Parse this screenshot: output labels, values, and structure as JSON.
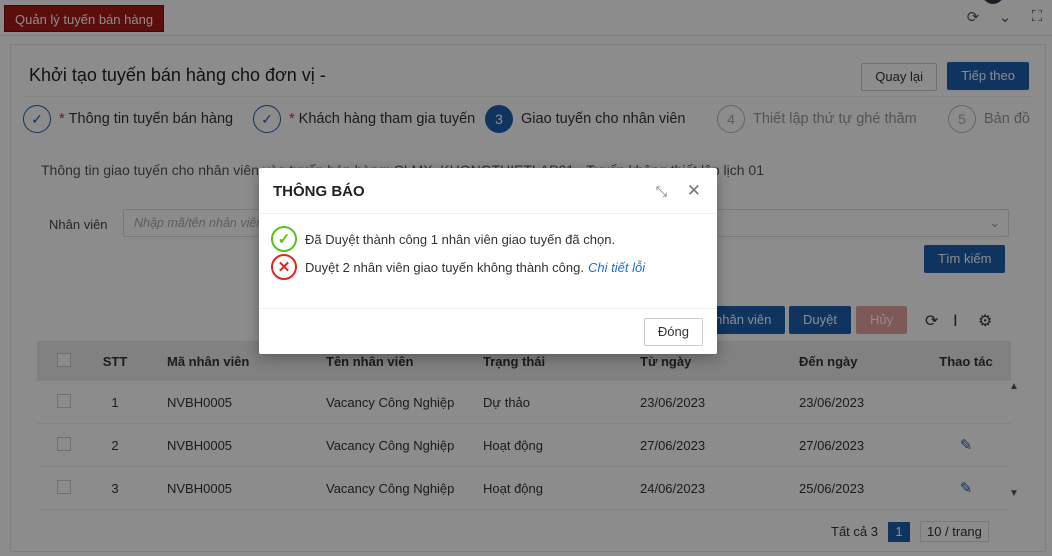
{
  "topbar": {
    "module_tab": "Quản lý tuyến bán hàng",
    "icons": [
      "refresh-icon",
      "chevron-down-icon",
      "fullscreen-icon"
    ]
  },
  "page": {
    "title": "Khởi tạo tuyến bán hàng cho đơn vị -",
    "back_label": "Quay lại",
    "next_label": "Tiếp theo"
  },
  "steps": [
    {
      "num": "✓",
      "label": "Thông tin tuyến bán hàng",
      "required": "*"
    },
    {
      "num": "✓",
      "label": "Khách hàng tham gia tuyến",
      "required": "*"
    },
    {
      "num": "3",
      "label": "Giao tuyến cho nhân viên"
    },
    {
      "num": "4",
      "label": "Thiết lập thứ tự ghé thăm"
    },
    {
      "num": "5",
      "label": "Bản đồ"
    }
  ],
  "section": {
    "title": "Thông tin giao tuyến cho nhân viên vào tuyến bán hàng: CLMX_KHONGTHIETLAP01 - Tuyến không thiết lập lịch 01"
  },
  "filter": {
    "label": "Nhân viên",
    "placeholder": "Nhập mã/tên nhân viên",
    "search_label": "Tìm kiếm"
  },
  "actions": {
    "assign_label": "nhân viên",
    "approve_label": "Duyệt",
    "cancel_label": "Hủy"
  },
  "table": {
    "headers": {
      "stt": "STT",
      "code": "Mã nhân viên",
      "name": "Tên nhân viên",
      "status": "Trạng thái",
      "from": "Từ ngày",
      "to": "Đến ngày",
      "action": "Thao tác"
    },
    "rows": [
      {
        "stt": "1",
        "code": "NVBH0005",
        "name": "Vacancy Công Nghiệp",
        "status": "Dự thảo",
        "from": "23/06/2023",
        "to": "23/06/2023",
        "action": ""
      },
      {
        "stt": "2",
        "code": "NVBH0005",
        "name": "Vacancy Công Nghiệp",
        "status": "Hoạt động",
        "from": "27/06/2023",
        "to": "27/06/2023",
        "action": "✎"
      },
      {
        "stt": "3",
        "code": "NVBH0005",
        "name": "Vacancy Công Nghiệp",
        "status": "Hoạt động",
        "from": "24/06/2023",
        "to": "25/06/2023",
        "action": "✎"
      }
    ]
  },
  "pager": {
    "total": "Tất cả 3",
    "page": "1",
    "size": "10 / trang"
  },
  "modal": {
    "title": "THÔNG BÁO",
    "success_msg": "Đã Duyệt thành công 1 nhân viên giao tuyến đã chọn.",
    "error_msg": "Duyệt 2 nhân viên giao tuyến không thành công.",
    "error_link": "Chi tiết lỗi",
    "close_label": "Đóng"
  },
  "colors": {
    "brand": "#1d5fae",
    "module_tab": "#a61a14",
    "success": "#52c41a",
    "error": "#e8231f"
  }
}
